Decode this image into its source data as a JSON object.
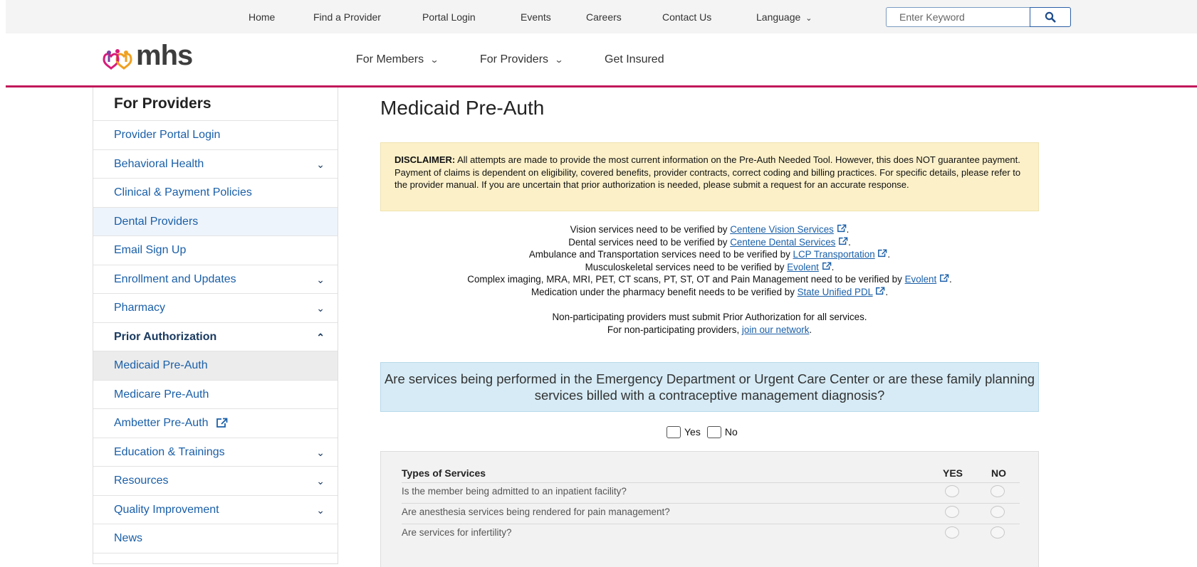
{
  "utility_nav": {
    "links": [
      "Home",
      "Find a Provider",
      "Portal Login",
      "Events",
      "Careers",
      "Contact Us"
    ],
    "language_label": "Language",
    "search_placeholder": "Enter Keyword"
  },
  "header": {
    "logo_text": "mhs",
    "nav": [
      {
        "label": "For Members",
        "has_dropdown": true
      },
      {
        "label": "For Providers",
        "has_dropdown": true
      },
      {
        "label": "Get Insured",
        "has_dropdown": false
      }
    ]
  },
  "sidebar": {
    "title": "For Providers",
    "items": [
      {
        "label": "Provider Portal Login"
      },
      {
        "label": "Behavioral Health",
        "chevron": "down"
      },
      {
        "label": "Clinical & Payment Policies"
      },
      {
        "label": "Dental Providers"
      },
      {
        "label": "Email Sign Up"
      },
      {
        "label": "Enrollment and Updates",
        "chevron": "down"
      },
      {
        "label": "Pharmacy",
        "chevron": "down"
      },
      {
        "label": "Prior Authorization",
        "chevron": "up"
      },
      {
        "label": "Medicaid Pre-Auth"
      },
      {
        "label": "Medicare Pre-Auth"
      },
      {
        "label": "Ambetter Pre-Auth",
        "external": true
      },
      {
        "label": "Education & Trainings",
        "chevron": "down"
      },
      {
        "label": "Resources",
        "chevron": "down"
      },
      {
        "label": "Quality Improvement",
        "chevron": "down"
      },
      {
        "label": "News"
      }
    ]
  },
  "main": {
    "title": "Medicaid Pre-Auth",
    "disclaimer": {
      "label": "DISCLAIMER:",
      "text": " All attempts are made to provide the most current information on the Pre-Auth Needed Tool. However, this does NOT guarantee payment. Payment of claims is dependent on eligibility, covered benefits, provider contracts, correct coding and billing practices. For specific details, please refer to the provider manual. If you are uncertain that prior authorization is needed, please submit a request for an accurate response."
    },
    "verify_lines": [
      {
        "before": "Vision services need to be verified by ",
        "link": "Centene Vision Services"
      },
      {
        "before": "Dental services need to be verified by ",
        "link": "Centene Dental Services"
      },
      {
        "before": "Ambulance and Transportation services need to be verified by ",
        "link": "LCP Transportation"
      },
      {
        "before": "Musculoskeletal services need to be verified by ",
        "link": "Evolent"
      },
      {
        "before": "Complex imaging, MRA, MRI, PET, CT scans, PT, ST, OT and Pain Management need to be verified by ",
        "link": "Evolent"
      },
      {
        "before": "Medication under the pharmacy benefit needs to be verified by ",
        "link": "State Unified PDL"
      }
    ],
    "nonpar_line": "Non-participating providers must submit Prior Authorization for all services.",
    "network_line": {
      "before": "For non-participating providers, ",
      "link": "join our network",
      "after": "."
    },
    "question": "Are services being performed in the Emergency Department or Urgent Care Center or are these family planning services billed with a contraceptive management diagnosis?",
    "yes_label": "Yes",
    "no_label": "No",
    "services": {
      "header": "Types of Services",
      "yes_col": "YES",
      "no_col": "NO",
      "rows": [
        "Is the member being admitted to an inpatient facility?",
        "Are anesthesia services being rendered for pain management?",
        "Are services for infertility?"
      ]
    }
  },
  "colors": {
    "accent": "#c2185b",
    "link": "#1a5fa8",
    "disclaimer_bg": "#fbf0c8",
    "question_bg": "#d6ebf5"
  }
}
